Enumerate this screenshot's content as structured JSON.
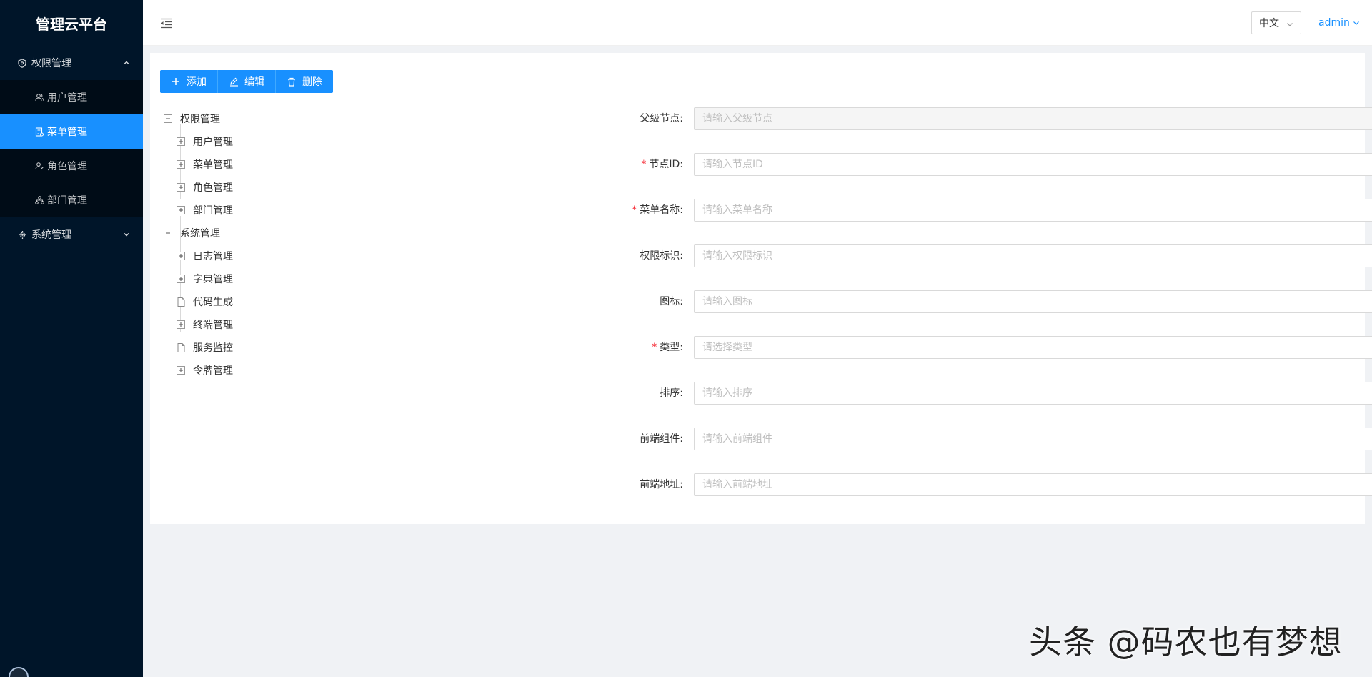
{
  "sidebar": {
    "logo": "管理云平台",
    "groups": [
      {
        "label": "权限管理",
        "icon": "shield-icon",
        "expanded": true,
        "items": [
          {
            "label": "用户管理",
            "icon": "user-group-icon",
            "active": false
          },
          {
            "label": "菜单管理",
            "icon": "document-icon",
            "active": true
          },
          {
            "label": "角色管理",
            "icon": "user-edit-icon",
            "active": false
          },
          {
            "label": "部门管理",
            "icon": "org-tree-icon",
            "active": false
          }
        ]
      },
      {
        "label": "系统管理",
        "icon": "gear-cube-icon",
        "expanded": false,
        "items": []
      }
    ]
  },
  "header": {
    "language": "中文",
    "user": "admin"
  },
  "toolbar": {
    "add_label": "添加",
    "edit_label": "编辑",
    "delete_label": "删除"
  },
  "tree": [
    {
      "label": "权限管理",
      "expanded": true,
      "children": [
        {
          "label": "用户管理",
          "type": "folder"
        },
        {
          "label": "菜单管理",
          "type": "folder"
        },
        {
          "label": "角色管理",
          "type": "folder"
        },
        {
          "label": "部门管理",
          "type": "folder"
        }
      ]
    },
    {
      "label": "系统管理",
      "expanded": true,
      "children": [
        {
          "label": "日志管理",
          "type": "folder"
        },
        {
          "label": "字典管理",
          "type": "folder"
        },
        {
          "label": "代码生成",
          "type": "leaf"
        },
        {
          "label": "终端管理",
          "type": "folder"
        },
        {
          "label": "服务监控",
          "type": "leaf"
        },
        {
          "label": "令牌管理",
          "type": "folder"
        }
      ]
    }
  ],
  "form": {
    "fields": [
      {
        "label": "父级节点",
        "placeholder": "请输入父级节点",
        "required": false,
        "type": "input",
        "disabled": true
      },
      {
        "label": "节点ID",
        "placeholder": "请输入节点ID",
        "required": true,
        "type": "input",
        "disabled": false
      },
      {
        "label": "菜单名称",
        "placeholder": "请输入菜单名称",
        "required": true,
        "type": "input",
        "disabled": false
      },
      {
        "label": "权限标识",
        "placeholder": "请输入权限标识",
        "required": false,
        "type": "input",
        "disabled": false
      },
      {
        "label": "图标",
        "placeholder": "请输入图标",
        "required": false,
        "type": "input",
        "disabled": false
      },
      {
        "label": "类型",
        "placeholder": "请选择类型",
        "required": true,
        "type": "select",
        "disabled": false
      },
      {
        "label": "排序",
        "placeholder": "请输入排序",
        "required": false,
        "type": "input",
        "disabled": false
      },
      {
        "label": "前端组件",
        "placeholder": "请输入前端组件",
        "required": false,
        "type": "input",
        "disabled": false
      },
      {
        "label": "前端地址",
        "placeholder": "请输入前端地址",
        "required": false,
        "type": "input",
        "disabled": false
      }
    ],
    "label_suffix": ":"
  },
  "watermark": "头条 @码农也有梦想",
  "colors": {
    "sidebar_bg": "#001529",
    "submenu_bg": "#000c17",
    "primary": "#1890ff",
    "required": "#f5222d"
  }
}
